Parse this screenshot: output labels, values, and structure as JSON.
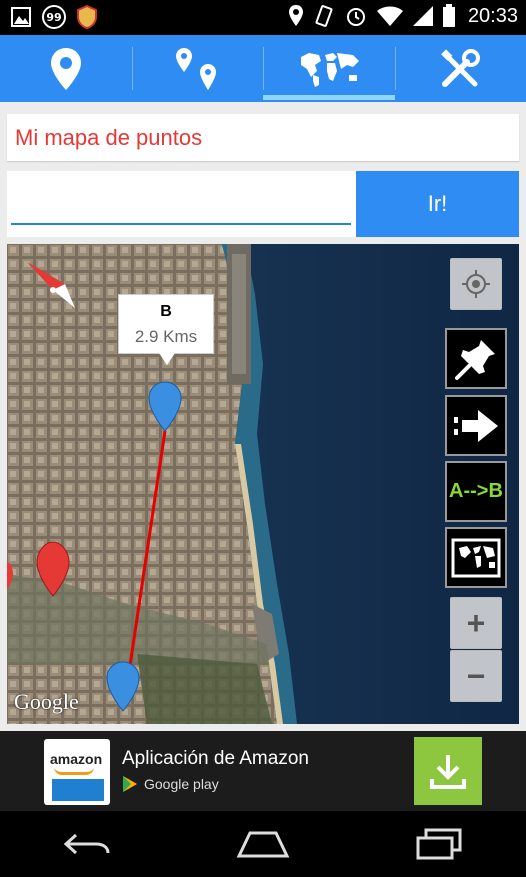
{
  "status_bar": {
    "time": "20:33",
    "notification_badge": "99",
    "left_icons": [
      "gallery-icon",
      "notification-count-icon",
      "shield-icon"
    ],
    "right_icons": [
      "location-icon",
      "vibrate-icon",
      "alarm-icon",
      "wifi-icon",
      "signal-icon",
      "battery-icon"
    ]
  },
  "tabs": [
    {
      "icon": "location-pin-icon",
      "active": false
    },
    {
      "icon": "multiple-pins-icon",
      "active": false
    },
    {
      "icon": "world-map-icon",
      "active": true
    },
    {
      "icon": "tools-icon",
      "active": false
    }
  ],
  "title": "Mi mapa de puntos",
  "search": {
    "value": "",
    "placeholder": "",
    "go_label": "Ir!"
  },
  "map": {
    "callout_title": "B",
    "callout_distance": "2.9 Kms",
    "attribution": "Google",
    "controls": [
      "my-location",
      "drop-pin",
      "directions-arrow",
      "a-to-b",
      "map-type",
      "zoom-in",
      "zoom-out"
    ],
    "ab_label": "A-->B",
    "zoom_in": "+",
    "zoom_out": "−",
    "colors": {
      "route": "#e60000",
      "pin_blue": "#3b8fe0",
      "pin_red": "#e53935",
      "sea": "#16304d"
    }
  },
  "ad": {
    "brand": "amazon",
    "title": "Aplicación de Amazon",
    "store": "Google play"
  },
  "nav": [
    "back-icon",
    "home-icon",
    "recent-apps-icon"
  ]
}
